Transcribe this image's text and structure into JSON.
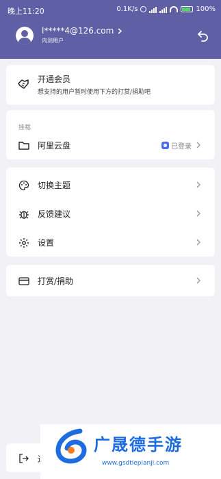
{
  "status_bar": {
    "time": "晚上11:20",
    "speed": "0.1K/s",
    "battery": "100%"
  },
  "profile": {
    "email": "l*****4@126.com",
    "role": "内测用户"
  },
  "vip": {
    "title": "开通会员",
    "subtitle": "想支持的用户暂时使用下方的打赏/捐助吧"
  },
  "mount": {
    "section_label": "挂载",
    "items": [
      {
        "label": "阿里云盘",
        "status": "已登录"
      }
    ]
  },
  "settings_menu": {
    "items": [
      {
        "label": "切换主题"
      },
      {
        "label": "反馈建议"
      },
      {
        "label": "设置"
      }
    ]
  },
  "donate": {
    "label": "打赏/捐助"
  },
  "logout": {
    "label": "退"
  },
  "watermark": {
    "title": "广晟德手游",
    "url": "www.gsdtiepianji.com"
  },
  "colors": {
    "header": "#5f5fa6",
    "background": "#f2f2f6",
    "accent_blue": "#4b6cf2"
  }
}
